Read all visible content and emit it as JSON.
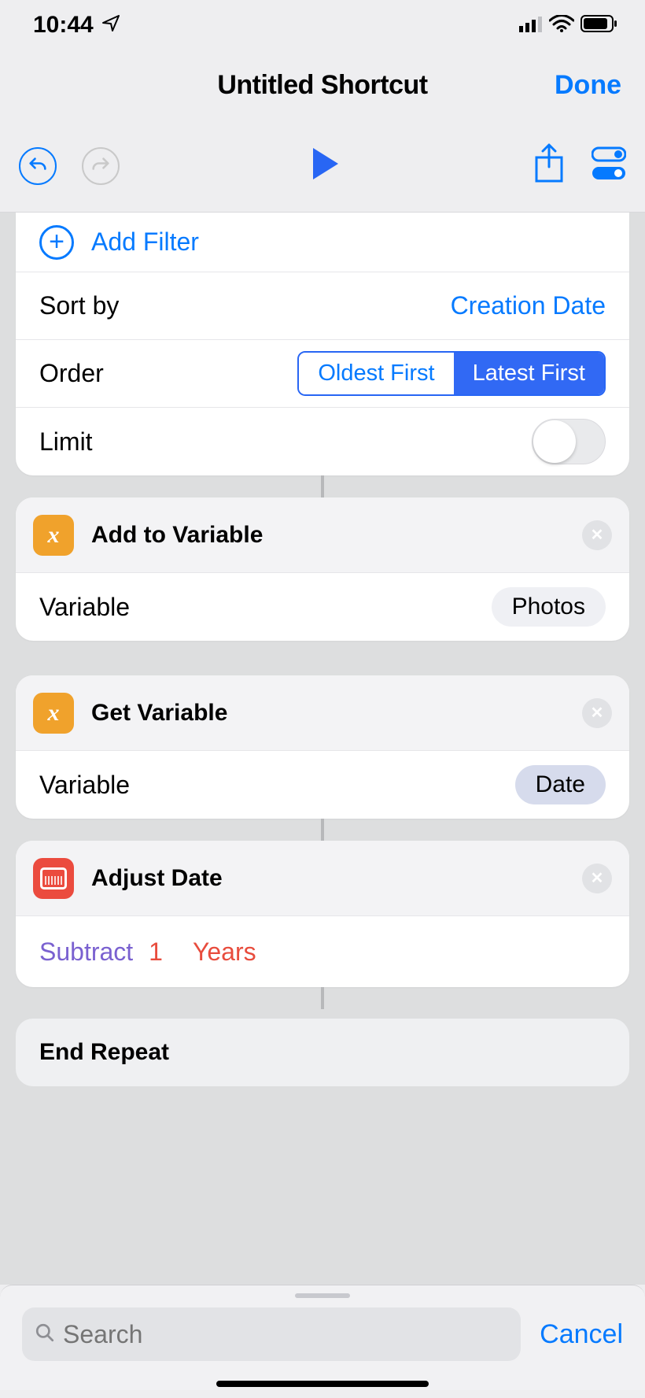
{
  "status": {
    "time": "10:44"
  },
  "header": {
    "title": "Untitled Shortcut",
    "done": "Done"
  },
  "filterCard": {
    "addFilter": "Add Filter",
    "sortBy": {
      "label": "Sort by",
      "value": "Creation Date"
    },
    "order": {
      "label": "Order",
      "opt1": "Oldest First",
      "opt2": "Latest First"
    },
    "limit": {
      "label": "Limit",
      "on": false
    }
  },
  "addToVariable": {
    "title": "Add to Variable",
    "paramLabel": "Variable",
    "paramValue": "Photos"
  },
  "getVariable": {
    "title": "Get Variable",
    "paramLabel": "Variable",
    "paramValue": "Date"
  },
  "adjustDate": {
    "title": "Adjust Date",
    "operation": "Subtract",
    "amount": "1",
    "unit": "Years"
  },
  "endRepeat": "End Repeat",
  "search": {
    "placeholder": "Search",
    "cancel": "Cancel"
  }
}
